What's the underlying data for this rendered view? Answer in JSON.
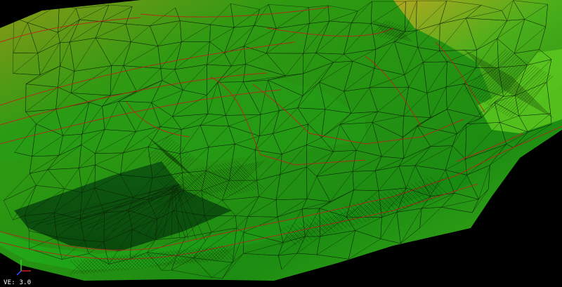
{
  "viewport": {
    "ve_label": "VE: 3.0",
    "background_color": "#000000",
    "surface_color_dark": "#0f6a10",
    "surface_color_mid": "#1f9a14",
    "surface_color_light": "#4fc61e",
    "highlight_color": "#a8b020",
    "breakline_color": "#c0201a",
    "mesh_line_color": "#0a1a05",
    "axis_triad_icon": "xyz-axis-triad-icon"
  }
}
